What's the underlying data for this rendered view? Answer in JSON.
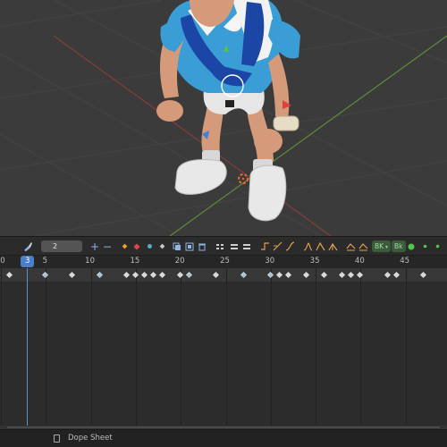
{
  "editor": {
    "name": "Dope Sheet",
    "mode_icon": "brush-icon"
  },
  "toolbar": {
    "frame_step": "2",
    "bake_label_1": "BK",
    "bake_label_2": "Bk"
  },
  "timeline": {
    "current_frame": "3",
    "tick_labels": [
      "0",
      "5",
      "10",
      "15",
      "20",
      "25",
      "30",
      "35",
      "40",
      "45"
    ],
    "keyframes": [
      0,
      4,
      7,
      10,
      13,
      14,
      15,
      16,
      17,
      19,
      20,
      23,
      26,
      29,
      30,
      31,
      33,
      35,
      37,
      38,
      39,
      42,
      43,
      46
    ],
    "selected_keyframes": [
      4,
      10,
      20,
      26,
      29
    ]
  },
  "status": {
    "label": "Dope Sheet"
  }
}
